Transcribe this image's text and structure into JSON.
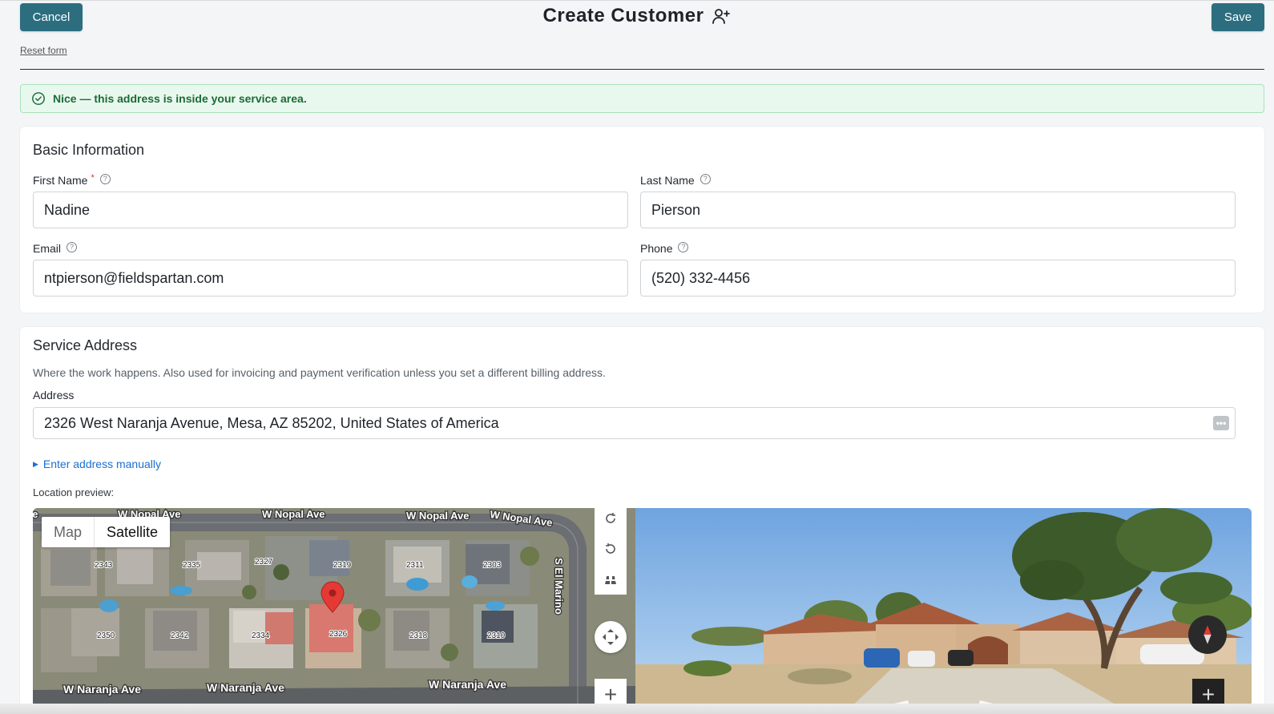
{
  "header": {
    "title": "Create Customer",
    "cancel_label": "Cancel",
    "save_label": "Save",
    "reset_label": "Reset form"
  },
  "alert": {
    "text": "Nice — this address is inside your service area."
  },
  "basic_info": {
    "title": "Basic Information",
    "first_name_label": "First Name",
    "first_name_required": "*",
    "first_name_value": "Nadine",
    "last_name_label": "Last Name",
    "last_name_value": "Pierson",
    "email_label": "Email",
    "email_value": "ntpierson@fieldspartan.com",
    "phone_label": "Phone",
    "phone_value": "(520) 332-4456"
  },
  "service_address": {
    "title": "Service Address",
    "description": "Where the work happens. Also used for invoicing and payment verification unless you set a different billing address.",
    "address_label": "Address",
    "address_value": "2326 West Naranja Avenue, Mesa, AZ 85202, United States of America",
    "manual_link": "Enter address manually",
    "location_preview_label": "Location preview:"
  },
  "map": {
    "map_tab": "Map",
    "satellite_tab": "Satellite",
    "streets": [
      "W Nopal Ave",
      "W Nopal Ave",
      "W Nopal Ave",
      "W Nopal Ave",
      "W Naranja Ave",
      "W Naranja Ave",
      "W Naranja Ave",
      "S El Marino"
    ],
    "house_numbers": [
      "2343",
      "2335",
      "2327",
      "2319",
      "2311",
      "2303",
      "2350",
      "2342",
      "2334",
      "2326",
      "2318",
      "2310"
    ]
  },
  "colors": {
    "primary": "#2c6e7f",
    "success_bg": "#e9f8ee",
    "success_text": "#1b6b36",
    "link": "#1a6fd1",
    "pin": "#e53935"
  }
}
